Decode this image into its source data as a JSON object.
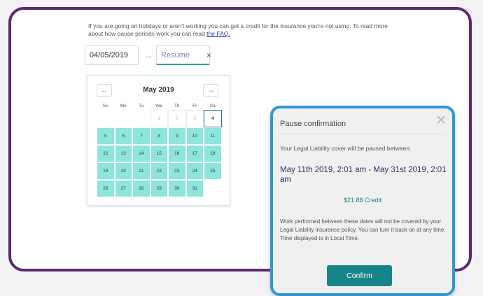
{
  "intro": {
    "text": "If you are going on holidays or aren't working you can get a credit for the insurance you're not using. To read more about how pause periods work you can read ",
    "link": "the FAQ."
  },
  "date_range": {
    "start_value": "04/05/2019",
    "arrow": "→",
    "end_placeholder": "Resume",
    "clear": "×"
  },
  "calendar": {
    "month": "May 2019",
    "prev": "←",
    "next": "→",
    "weekdays": [
      "Su",
      "Mo",
      "Tu",
      "We",
      "Th",
      "Fr",
      "Sa"
    ],
    "days": [
      {
        "d": "",
        "s": "empty"
      },
      {
        "d": "",
        "s": "empty"
      },
      {
        "d": "",
        "s": "empty"
      },
      {
        "d": "1",
        "s": "dis"
      },
      {
        "d": "2",
        "s": "dis"
      },
      {
        "d": "3",
        "s": "dis"
      },
      {
        "d": "4",
        "s": "today"
      },
      {
        "d": "5",
        "s": "sel"
      },
      {
        "d": "6",
        "s": "sel"
      },
      {
        "d": "7",
        "s": "sel"
      },
      {
        "d": "8",
        "s": "sel"
      },
      {
        "d": "9",
        "s": "sel"
      },
      {
        "d": "10",
        "s": "sel"
      },
      {
        "d": "11",
        "s": "sel"
      },
      {
        "d": "12",
        "s": "sel"
      },
      {
        "d": "13",
        "s": "sel"
      },
      {
        "d": "14",
        "s": "sel"
      },
      {
        "d": "15",
        "s": "sel"
      },
      {
        "d": "16",
        "s": "sel"
      },
      {
        "d": "17",
        "s": "sel"
      },
      {
        "d": "18",
        "s": "sel"
      },
      {
        "d": "19",
        "s": "sel"
      },
      {
        "d": "20",
        "s": "sel"
      },
      {
        "d": "21",
        "s": "sel"
      },
      {
        "d": "22",
        "s": "sel"
      },
      {
        "d": "23",
        "s": "sel"
      },
      {
        "d": "24",
        "s": "sel"
      },
      {
        "d": "25",
        "s": "sel"
      },
      {
        "d": "26",
        "s": "sel"
      },
      {
        "d": "27",
        "s": "sel"
      },
      {
        "d": "28",
        "s": "sel"
      },
      {
        "d": "29",
        "s": "sel"
      },
      {
        "d": "30",
        "s": "sel"
      },
      {
        "d": "31",
        "s": "sel"
      }
    ]
  },
  "modal": {
    "title": "Pause confirmation",
    "close": "✕",
    "subtitle": "Your Legal Liability cover will be paused between:",
    "range": "May 11th 2019, 2:01 am - May 31st 2019, 2:01 am",
    "credit": "$21.88 Credit",
    "note": "Work performed between these dates will not be covered by your Legal Liability insurance policy. You can turn it back on at any time. Time displayed is in Local Time.",
    "confirm": "Confirm"
  },
  "colors": {
    "frame": "#5b2a73",
    "modal_border": "#2f97d6",
    "selected_day": "#8de5dc",
    "confirm_button": "#17868a"
  }
}
